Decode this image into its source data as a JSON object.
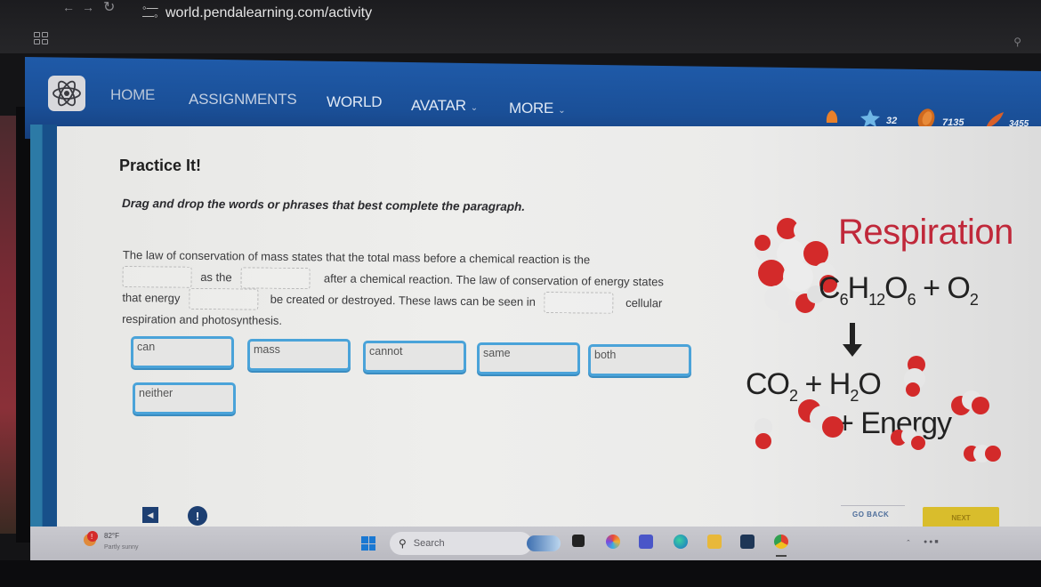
{
  "browser": {
    "url": "world.pendalearning.com/activity",
    "back_icon": "arrow-left",
    "forward_icon": "arrow-right",
    "reload_icon": "reload"
  },
  "header": {
    "logo": "atom-logo",
    "nav": [
      {
        "label": "HOME",
        "has_dropdown": false
      },
      {
        "label": "ASSIGNMENTS",
        "has_dropdown": false
      },
      {
        "label": "WORLD",
        "has_dropdown": false
      },
      {
        "label": "AVATAR",
        "has_dropdown": true
      },
      {
        "label": "MORE",
        "has_dropdown": true
      }
    ],
    "stats": {
      "bell_icon": "bell",
      "stars": "32",
      "coins": "7135",
      "feathers": "3455"
    }
  },
  "activity": {
    "title": "Practice It!",
    "instructions": "Drag and drop the words or phrases that best complete the paragraph.",
    "paragraph": {
      "line1": "The law of conservation of mass states that the total mass before a chemical reaction is the",
      "line2_a": "as the",
      "line2_b": "after a chemical reaction. The law of conservation of energy states",
      "line3_a": "that energy",
      "line3_b": "be created or destroyed. These laws can be seen in",
      "line3_c": "cellular",
      "line4": "respiration and photosynthesis."
    },
    "word_bank": [
      "can",
      "mass",
      "cannot",
      "same",
      "both",
      "neither"
    ]
  },
  "illustration": {
    "title": "Respiration",
    "reactants": {
      "glucose": [
        "C",
        "6",
        "H",
        "12",
        "O",
        "6"
      ],
      "plus": "+",
      "oxygen": [
        "O",
        "2"
      ]
    },
    "products": {
      "co2": [
        "CO",
        "2"
      ],
      "plus": "+",
      "water": [
        "H",
        "2",
        "O"
      ],
      "energy": "+ Energy"
    },
    "colors": {
      "title": "#c0283a",
      "atom_red": "#d32a2a",
      "atom_white": "#e8e8e8"
    }
  },
  "controls": {
    "audio_icon": "speaker",
    "alert_label": "!",
    "go_back": "GO BACK",
    "next": "NEXT"
  },
  "taskbar": {
    "weather_temp": "82°F",
    "weather_desc": "Partly sunny",
    "search_placeholder": "Search"
  },
  "colors": {
    "header_blue": "#1f5aa8",
    "chip_border": "#4aa3d9",
    "next_yellow": "#d9bd2c"
  }
}
